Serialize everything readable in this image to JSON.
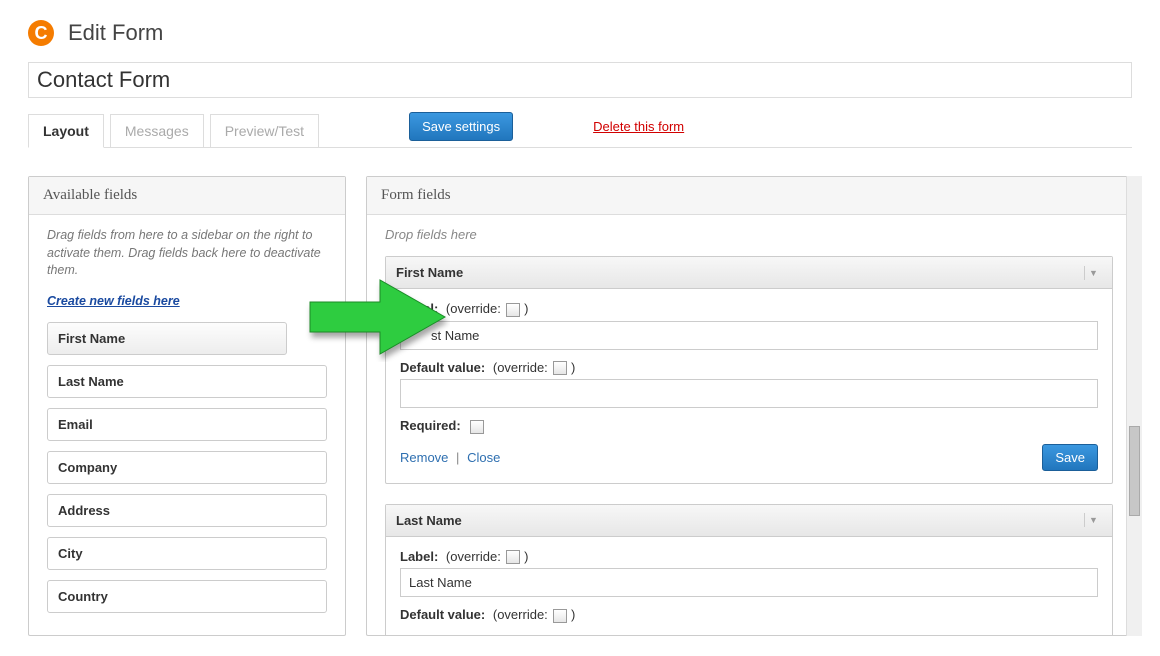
{
  "header": {
    "logo_letter": "C",
    "title": "Edit Form"
  },
  "form_name": "Contact Form",
  "tabs": [
    {
      "label": "Layout",
      "active": true
    },
    {
      "label": "Messages",
      "active": false
    },
    {
      "label": "Preview/Test",
      "active": false
    }
  ],
  "save_settings_label": "Save settings",
  "delete_form_label": "Delete this form",
  "available": {
    "title": "Available fields",
    "instructions": "Drag fields from here to a sidebar on the right to activate them. Drag fields back here to deactivate them.",
    "create_link": "Create new fields here",
    "items": [
      "First Name",
      "Last Name",
      "Email",
      "Company",
      "Address",
      "City",
      "Country"
    ]
  },
  "formfields": {
    "title": "Form fields",
    "drop_hint": "Drop fields here",
    "labels": {
      "label": "Label:",
      "override": "(override:",
      "close_paren": ")",
      "default_value": "Default value:",
      "required": "Required:",
      "remove": "Remove",
      "close": "Close",
      "save": "Save"
    },
    "entries": [
      {
        "name": "First Name",
        "label_value": "st Name",
        "label_value_full": "First Name",
        "default_value": "",
        "expanded": true,
        "show_actions": true
      },
      {
        "name": "Last Name",
        "label_value": "Last Name",
        "default_value": "",
        "expanded": true,
        "show_actions": false
      }
    ]
  }
}
